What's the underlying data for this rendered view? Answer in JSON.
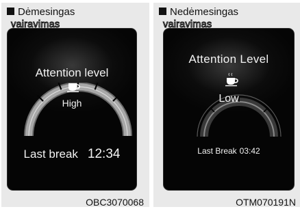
{
  "panels": [
    {
      "caption_line1": "Dėmesingas",
      "caption_line2": "vairavimas",
      "title": "Attention level",
      "level": "High",
      "break_label": "Last break",
      "break_time": "12:34",
      "code": "OBC3070068",
      "attention_fraction": 1.0,
      "icon": "coffee-cup-icon"
    },
    {
      "caption_line1": "Nedėmesingas",
      "caption_line2": "vairavimas",
      "title": "Attention Level",
      "level": "Low",
      "break_label": "Last Break",
      "break_time": "03:42",
      "code": "OTM070191N",
      "attention_fraction": 0.0,
      "icon": "steaming-coffee-cup-icon"
    }
  ],
  "colors": {
    "panel_bg": "#e9e9e9",
    "screen_bg": "#050505",
    "display_text": "#f2f2f2",
    "gauge_arc": "#8a8a8a"
  }
}
